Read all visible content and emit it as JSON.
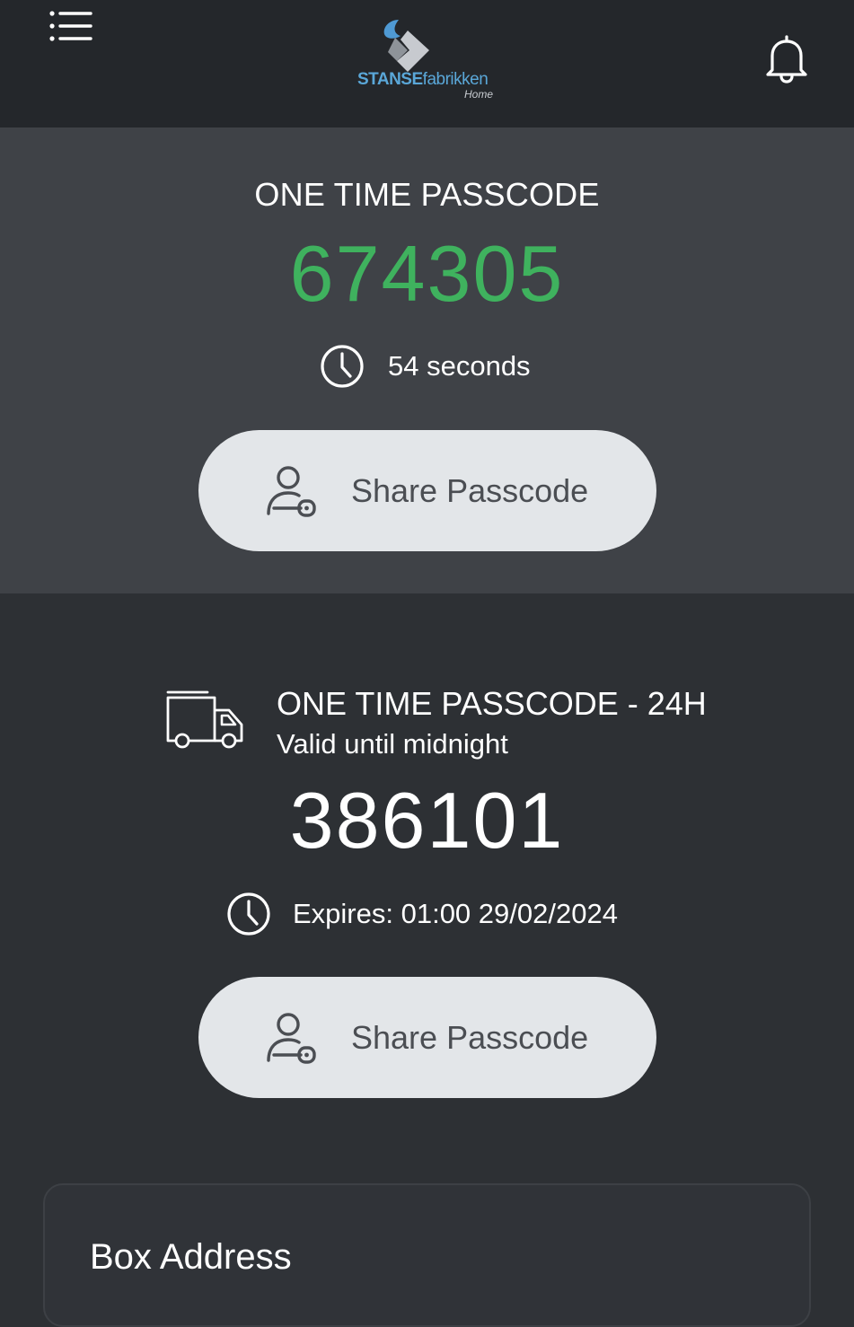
{
  "header": {
    "logo_brand_bold": "STANSE",
    "logo_brand_light": "fabrikken",
    "logo_sub": "Home",
    "menu_icon": "list-menu-icon",
    "bell_icon": "bell-icon"
  },
  "otp": {
    "title": "ONE TIME PASSCODE",
    "code": "674305",
    "timer_text": "54 seconds",
    "share_label": "Share Passcode",
    "code_color": "#3fb25e"
  },
  "day_otp": {
    "title": "ONE TIME PASSCODE - 24H",
    "subtitle": "Valid until midnight",
    "code": "386101",
    "expires_text": "Expires: 01:00 29/02/2024",
    "share_label": "Share Passcode"
  },
  "address": {
    "title": "Box Address"
  },
  "colors": {
    "header_bg": "#24272b",
    "otp_bg": "#3f4247",
    "day_bg": "#2d3034",
    "button_bg": "#e3e6e9",
    "logo_blue": "#5aa7d8"
  }
}
